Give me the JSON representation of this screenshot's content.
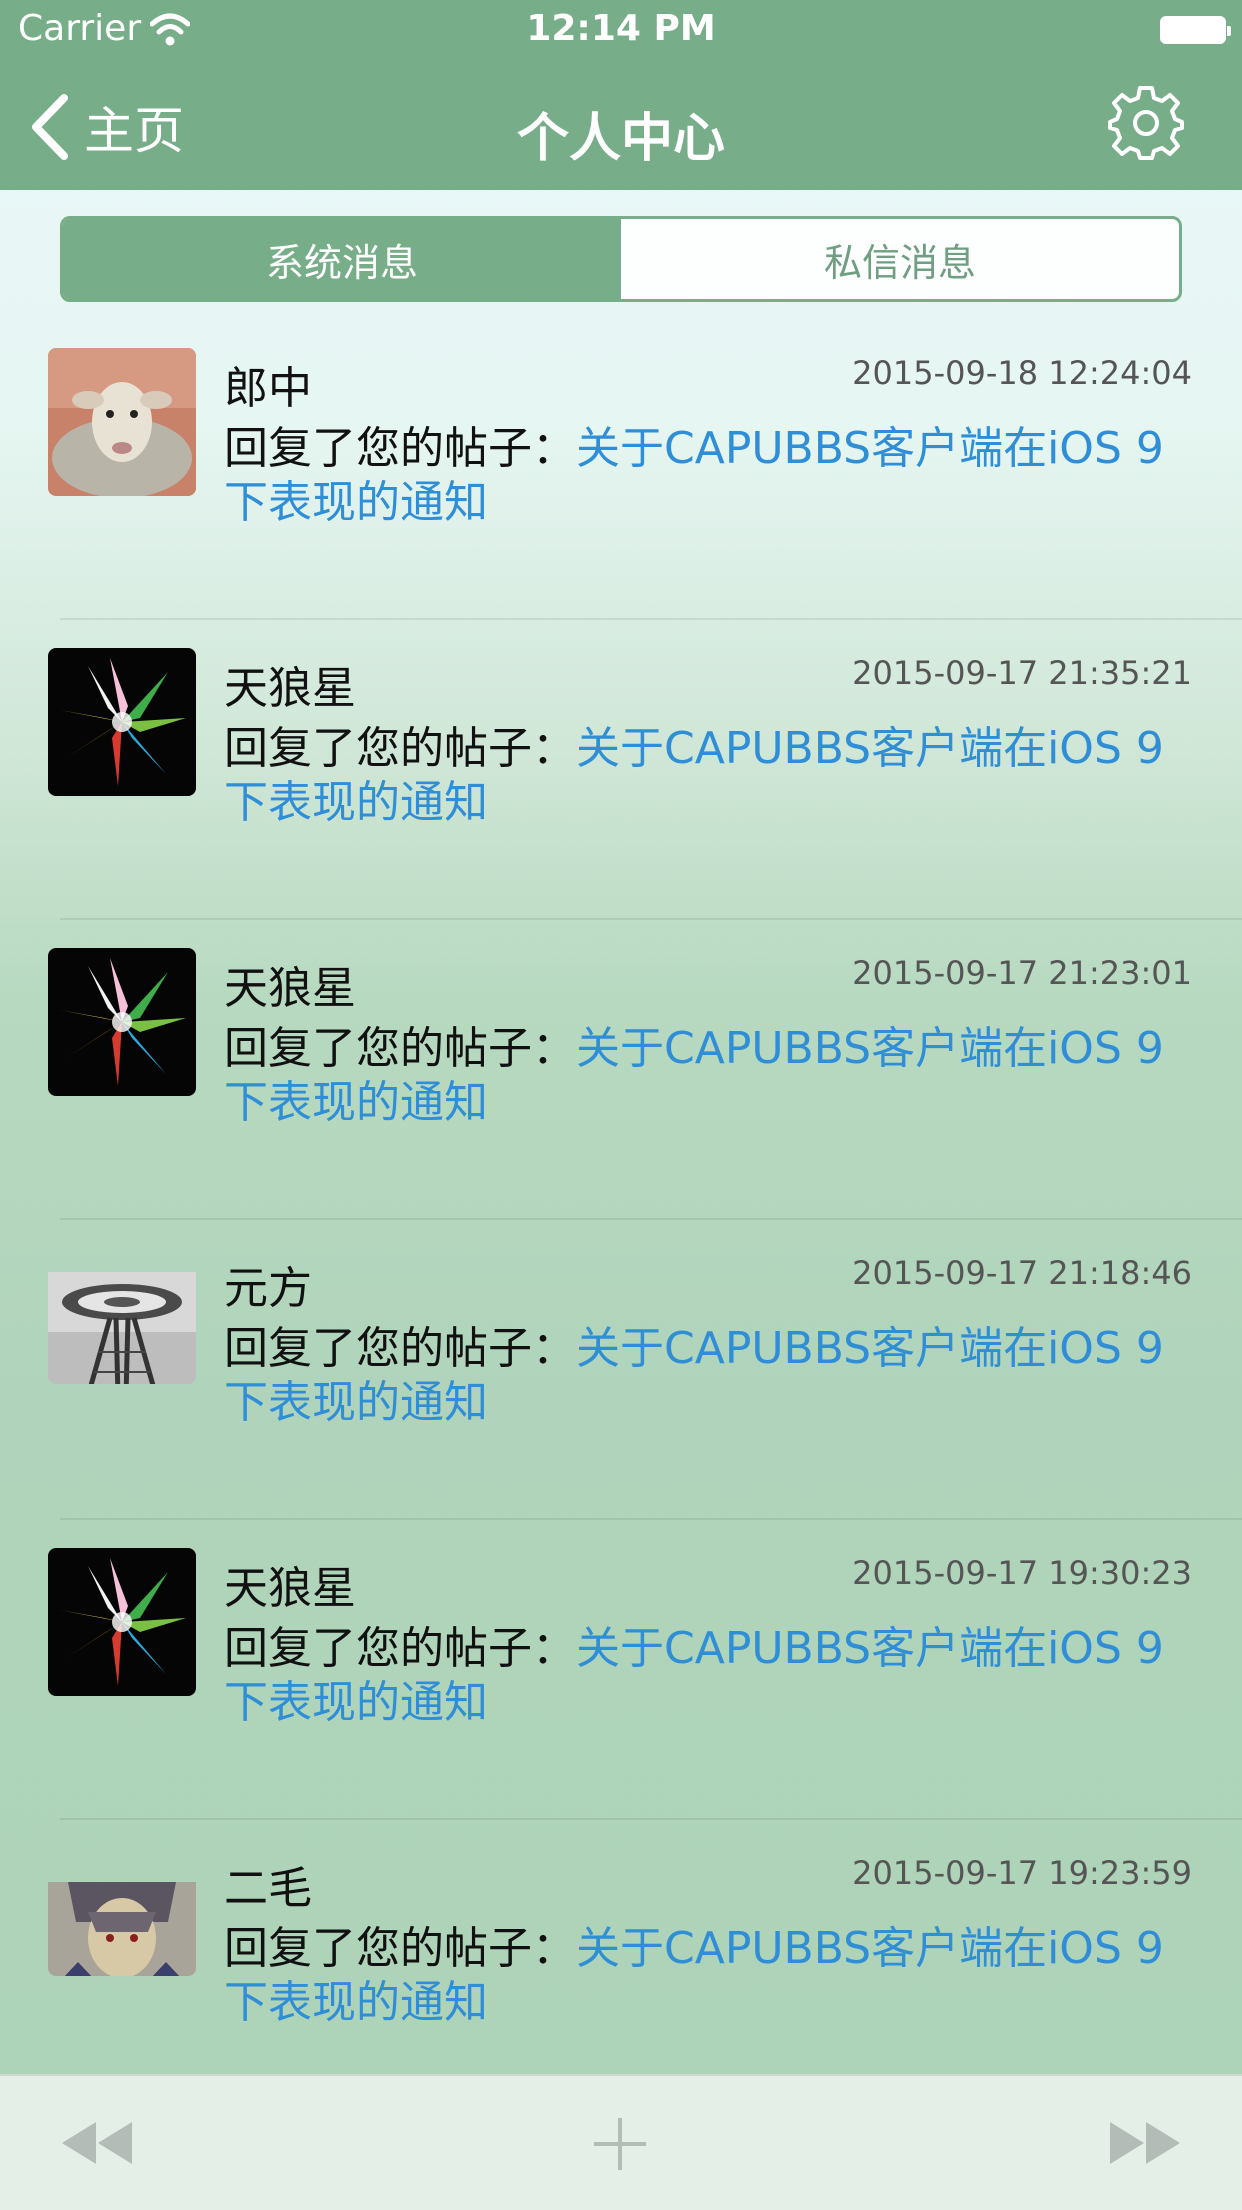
{
  "status_bar": {
    "carrier": "Carrier",
    "time": "12:14 PM"
  },
  "nav": {
    "back_label": "主页",
    "title": "个人中心"
  },
  "segments": [
    {
      "label": "系统消息",
      "active": true
    },
    {
      "label": "私信消息",
      "active": false
    }
  ],
  "messages": [
    {
      "author": "郎中",
      "time": "2015-09-18 12:24:04",
      "action": "回复了您的帖子：",
      "link_line1": "关于CAPUBBS客户端在iOS 9",
      "link_line2": "下表现的通知",
      "avatar": "sheep"
    },
    {
      "author": "天狼星",
      "time": "2015-09-17 21:35:21",
      "action": "回复了您的帖子：",
      "link_line1": "关于CAPUBBS客户端在iOS 9",
      "link_line2": "下表现的通知",
      "avatar": "color-burst"
    },
    {
      "author": "天狼星",
      "time": "2015-09-17 21:23:01",
      "action": "回复了您的帖子：",
      "link_line1": "关于CAPUBBS客户端在iOS 9",
      "link_line2": "下表现的通知",
      "avatar": "color-burst"
    },
    {
      "author": "元方",
      "time": "2015-09-17 21:18:46",
      "action": "回复了您的帖子：",
      "link_line1": "关于CAPUBBS客户端在iOS 9",
      "link_line2": "下表现的通知",
      "avatar": "space-needle"
    },
    {
      "author": "天狼星",
      "time": "2015-09-17 19:30:23",
      "action": "回复了您的帖子：",
      "link_line1": "关于CAPUBBS客户端在iOS 9",
      "link_line2": "下表现的通知",
      "avatar": "color-burst"
    },
    {
      "author": "二毛",
      "time": "2015-09-17 19:23:59",
      "action": "回复了您的帖子：",
      "link_line1": "关于CAPUBBS客户端在iOS 9",
      "link_line2": "下表现的通知",
      "avatar": "anime-character"
    }
  ],
  "colors": {
    "bar": "#77ad89",
    "link": "#2f8ed6",
    "text": "#111111"
  },
  "icons": {
    "back": "chevron-left-icon",
    "settings": "gear-icon",
    "first_page": "rewind-icon",
    "compose": "plus-icon",
    "last_page": "fast-forward-icon"
  }
}
